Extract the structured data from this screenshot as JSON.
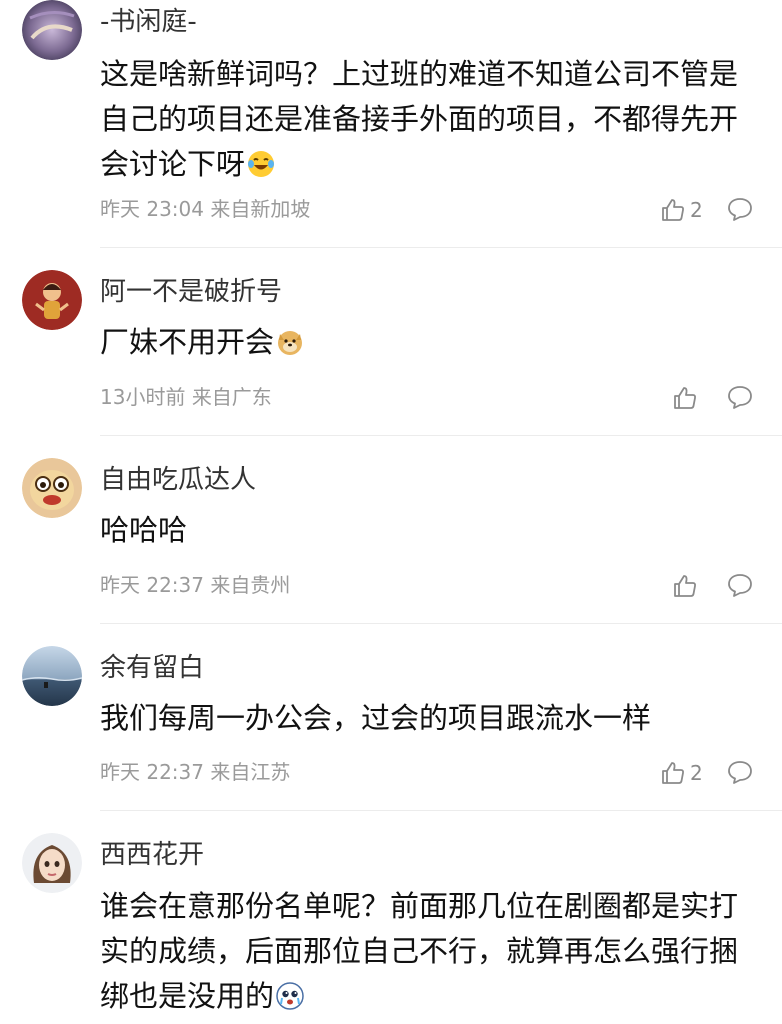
{
  "comments": [
    {
      "username": "-书闲庭-",
      "content": "这是啥新鲜词吗？上过班的难道不知道公司不管是自己的项目还是准备接手外面的项目，不都得先开会讨论下呀",
      "emoji": "laughing-tears-emoji",
      "time": "昨天 23:04",
      "location": "来自新加坡",
      "likes": "2"
    },
    {
      "username": "阿一不是破折号",
      "content": "厂妹不用开会",
      "emoji": "doge-emoji",
      "time": "13小时前",
      "location": "来自广东",
      "likes": ""
    },
    {
      "username": "自由吃瓜达人",
      "content": "哈哈哈",
      "emoji": "",
      "time": "昨天 22:37",
      "location": "来自贵州",
      "likes": ""
    },
    {
      "username": "余有留白",
      "content": "我们每周一办公会，过会的项目跟流水一样",
      "emoji": "",
      "time": "昨天 22:37",
      "location": "来自江苏",
      "likes": "2"
    },
    {
      "username": "西西花开",
      "content": "谁会在意那份名单呢？前面那几位在剧圈都是实打实的成绩，后面那位自己不行，就算再怎么强行捆绑也是没用的",
      "emoji": "crying-emoji",
      "time": "",
      "location": "",
      "likes": ""
    }
  ],
  "icons": {
    "like": "thumbs-up-icon",
    "reply": "comment-bubble-icon"
  },
  "colors": {
    "text": "#111111",
    "meta": "#9a9a9a",
    "divider": "#ececec"
  }
}
